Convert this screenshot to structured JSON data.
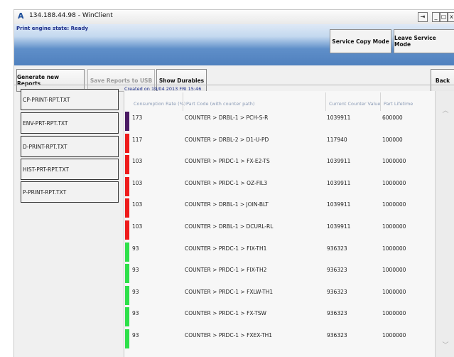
{
  "window": {
    "title": "134.188.44.98 - WinClient",
    "pin_glyph": "⇥",
    "minimize_glyph": "_",
    "maximize_glyph": "▢",
    "close_glyph": "x"
  },
  "banner": {
    "status_text": "Print engine state: Ready",
    "service_copy_label": "Service Copy Mode",
    "leave_service_label": "Leave Service Mode"
  },
  "toolbar": {
    "generate_label": "Generate new Reports",
    "save_usb_label": "Save Reports to USB",
    "show_durables_label": "Show Durables",
    "back_label": "Back"
  },
  "sidebar": {
    "items": [
      {
        "label": "CP-PRINT-RPT.TXT"
      },
      {
        "label": "ENV-PRT-RPT.TXT"
      },
      {
        "label": "D-PRINT-RPT.TXT"
      },
      {
        "label": "HIST-PRT-RPT.TXT"
      },
      {
        "label": "P-PRINT-RPT.TXT"
      }
    ]
  },
  "report": {
    "created": "Created on 19/04 2013 FRI 15:46",
    "columns": {
      "rate": "Consumption Rate (%)",
      "part": "Part Code (with counter path)",
      "counter": "Current Counter Value",
      "lifetime": "Part Lifetime"
    },
    "rows": [
      {
        "rate": "173",
        "part": "COUNTER > DRBL-1 > PCH-S-R",
        "counter": "1039911",
        "lifetime": "600000",
        "color": "#4a1a63"
      },
      {
        "rate": "117",
        "part": "COUNTER > DRBL-2 > D1-U-PD",
        "counter": "117940",
        "lifetime": "100000",
        "color": "#ee1c1c"
      },
      {
        "rate": "103",
        "part": "COUNTER > PRDC-1 > FX-E2-TS",
        "counter": "1039911",
        "lifetime": "1000000",
        "color": "#ee1c1c"
      },
      {
        "rate": "103",
        "part": "COUNTER > PRDC-1 > OZ-FIL3",
        "counter": "1039911",
        "lifetime": "1000000",
        "color": "#ee1c1c"
      },
      {
        "rate": "103",
        "part": "COUNTER > DRBL-1 > JOIN-BLT",
        "counter": "1039911",
        "lifetime": "1000000",
        "color": "#ee1c1c"
      },
      {
        "rate": "103",
        "part": "COUNTER > DRBL-1 > DCURL-RL",
        "counter": "1039911",
        "lifetime": "1000000",
        "color": "#ee1c1c"
      },
      {
        "rate": "93",
        "part": "COUNTER > PRDC-1 > FIX-TH1",
        "counter": "936323",
        "lifetime": "1000000",
        "color": "#2ee04a"
      },
      {
        "rate": "93",
        "part": "COUNTER > PRDC-1 > FIX-TH2",
        "counter": "936323",
        "lifetime": "1000000",
        "color": "#2ee04a"
      },
      {
        "rate": "93",
        "part": "COUNTER > PRDC-1 > FXLW-TH1",
        "counter": "936323",
        "lifetime": "1000000",
        "color": "#2ee04a"
      },
      {
        "rate": "93",
        "part": "COUNTER > PRDC-1 > FX-TSW",
        "counter": "936323",
        "lifetime": "1000000",
        "color": "#2ee04a"
      },
      {
        "rate": "93",
        "part": "COUNTER > PRDC-1 > FXEX-TH1",
        "counter": "936323",
        "lifetime": "1000000",
        "color": "#2ee04a"
      }
    ]
  },
  "scrollbar": {
    "up_icon": "︿",
    "down_icon": "﹀"
  }
}
